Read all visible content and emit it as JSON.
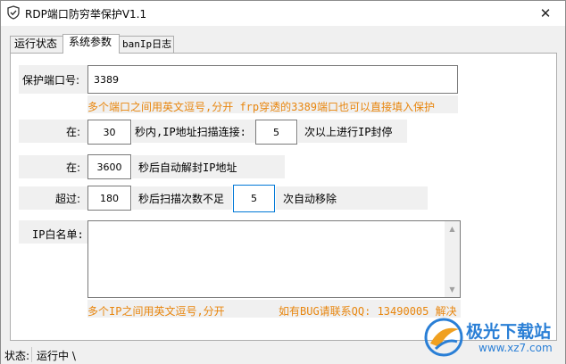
{
  "window": {
    "title": "RDP端口防穷举保护V1.1",
    "close_glyph": "✕"
  },
  "tabs": [
    {
      "label": "运行状态",
      "active": false
    },
    {
      "label": "系统参数",
      "active": true
    },
    {
      "label": "banIp日志",
      "active": false
    }
  ],
  "form": {
    "port_label": "保护端口号:",
    "port_value": "3389",
    "port_hint": "多个端口之间用英文逗号,分开 frp穿透的3389端口也可以直接填入保护",
    "row1_label": "在:",
    "row1_value": "30",
    "row1_mid": "秒内,IP地址扫描连接:",
    "row1_value2": "5",
    "row1_tail": "次以上进行IP封停",
    "row2_label": "在:",
    "row2_value": "3600",
    "row2_tail": "秒后自动解封IP地址",
    "row3_label": "超过:",
    "row3_value": "180",
    "row3_mid": "秒后扫描次数不足",
    "row3_value2": "5",
    "row3_tail": "次自动移除",
    "whitelist_label": "IP白名单:",
    "whitelist_value": "",
    "whitelist_hint": "多个IP之间用英文逗号,分开",
    "bug_hint": "如有BUG请联系QQ: 13490005 解决"
  },
  "status": {
    "label": "状态:",
    "value": "运行中 \\"
  },
  "watermark": {
    "text": "极光下载站",
    "url": "www.xz7.com"
  },
  "colors": {
    "hint": "#e8860e",
    "focus_border": "#0078d7",
    "watermark": "#2a7fd6"
  },
  "icons": {
    "app": "shield-check-icon",
    "close": "close-icon"
  }
}
